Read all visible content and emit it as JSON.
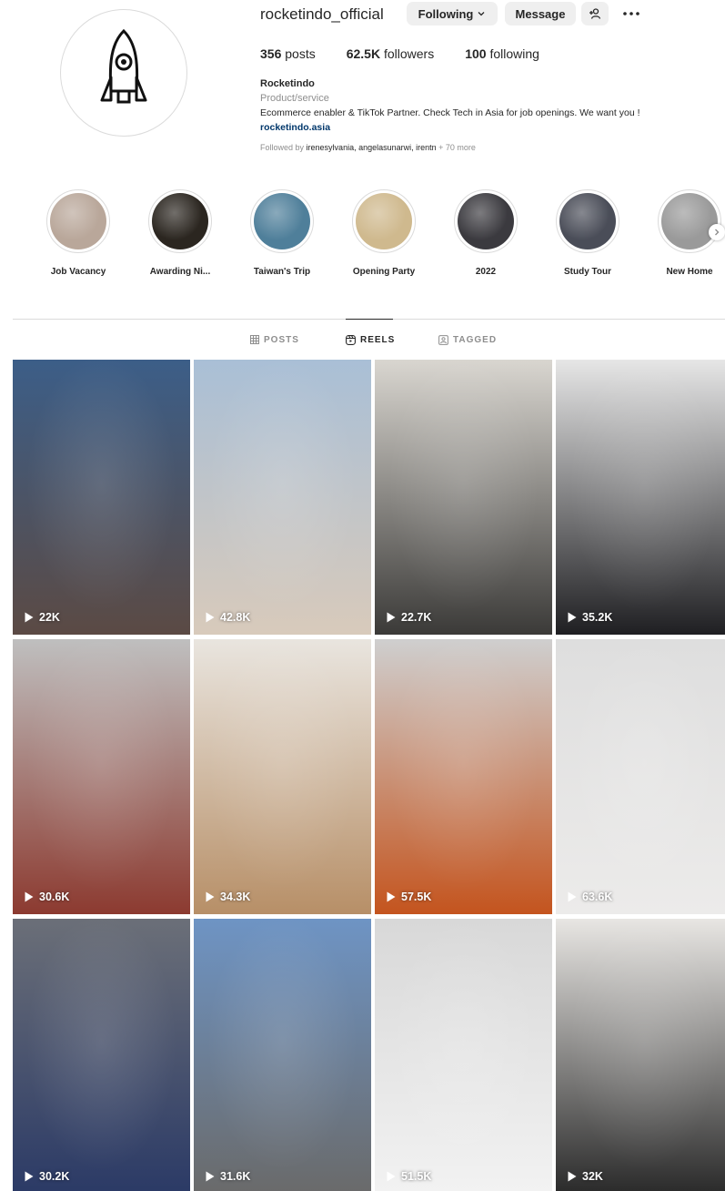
{
  "profile": {
    "username": "rocketindo_official",
    "following_button": "Following",
    "message_button": "Message",
    "posts_count": "356",
    "posts_label": "posts",
    "followers_count": "62.5K",
    "followers_label": "followers",
    "following_count": "100",
    "following_label": "following",
    "name": "Rocketindo",
    "category": "Product/service",
    "description": "Ecommerce enabler & TikTok Partner. Check Tech in Asia for job openings. We want you !",
    "link": "rocketindo.asia",
    "followed_by_prefix": "Followed by",
    "followed_by_names": "irenesylvania, angelasunarwi, irentn",
    "followed_by_more": "+ 70 more"
  },
  "highlights": [
    {
      "label": "Job Vacancy",
      "color": "#b9a79a"
    },
    {
      "label": "Awarding Ni...",
      "color": "#2b2620"
    },
    {
      "label": "Taiwan's Trip",
      "color": "#4f7f9a"
    },
    {
      "label": "Opening Party",
      "color": "#cfb98e"
    },
    {
      "label": "2022",
      "color": "#3b3a3f"
    },
    {
      "label": "Study Tour",
      "color": "#4a4d58"
    },
    {
      "label": "New Home",
      "color": "#9a9a9a"
    }
  ],
  "tabs": [
    {
      "label": "POSTS",
      "active": false
    },
    {
      "label": "REELS",
      "active": true
    },
    {
      "label": "TAGGED",
      "active": false
    }
  ],
  "reels": [
    {
      "views": "22K",
      "top": "#3c5e88",
      "bottom": "#5b4a44"
    },
    {
      "views": "42.8K",
      "top": "#a9bfd6",
      "bottom": "#d8cabb"
    },
    {
      "views": "22.7K",
      "top": "#d9d6d0",
      "bottom": "#3b3a38"
    },
    {
      "views": "35.2K",
      "top": "#e6e6e6",
      "bottom": "#1f1f22"
    },
    {
      "views": "30.6K",
      "top": "#bfbfbf",
      "bottom": "#8c3a30"
    },
    {
      "views": "34.3K",
      "top": "#e9e5df",
      "bottom": "#b78f67"
    },
    {
      "views": "57.5K",
      "top": "#cfcfcf",
      "bottom": "#c4541e"
    },
    {
      "views": "63.6K",
      "top": "#dedede",
      "bottom": "#ecebea"
    },
    {
      "views": "30.2K",
      "top": "#6b6f78",
      "bottom": "#2b3a66"
    },
    {
      "views": "31.6K",
      "top": "#6e94c4",
      "bottom": "#6a6a6a"
    },
    {
      "views": "51.5K",
      "top": "#d8d8d8",
      "bottom": "#f2f2f2"
    },
    {
      "views": "32K",
      "top": "#e8e6e3",
      "bottom": "#2a2a2a"
    }
  ]
}
